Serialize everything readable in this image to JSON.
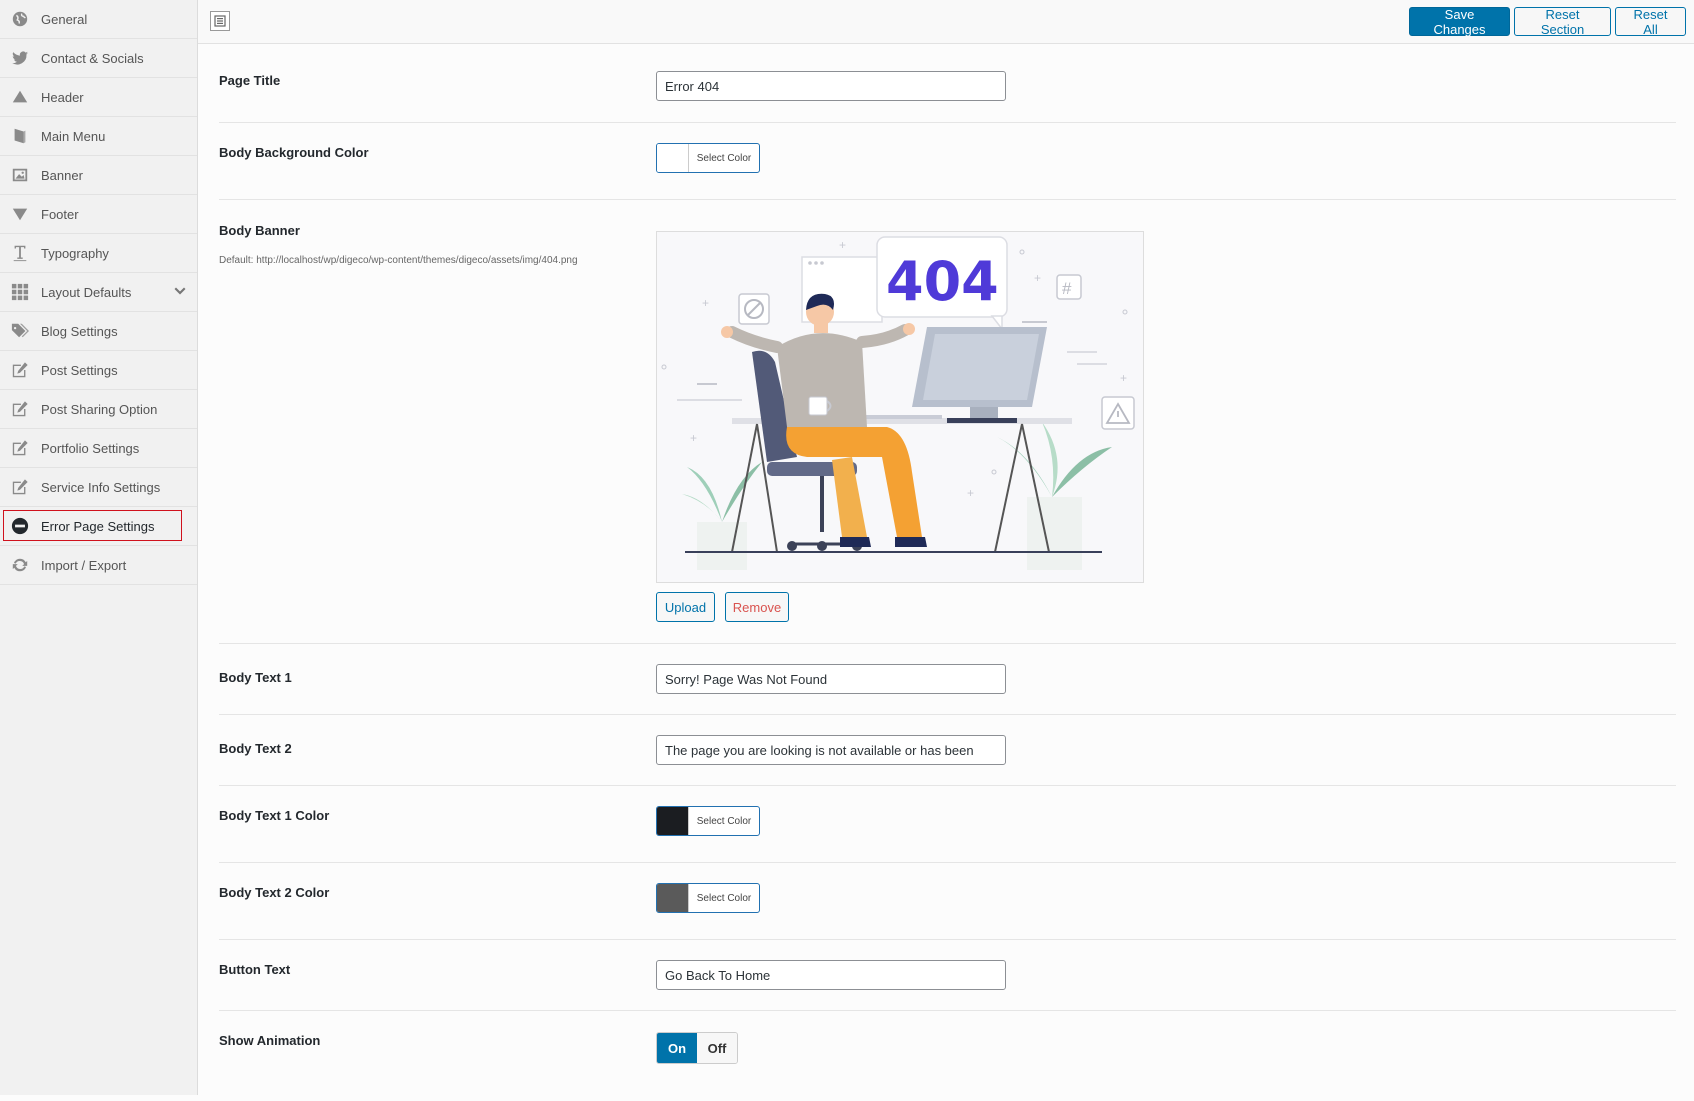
{
  "sidebar": {
    "items": [
      {
        "label": "General",
        "icon": "globe-icon"
      },
      {
        "label": "Contact & Socials",
        "icon": "twitter-icon"
      },
      {
        "label": "Header",
        "icon": "triangle-up-icon"
      },
      {
        "label": "Main Menu",
        "icon": "book-icon"
      },
      {
        "label": "Banner",
        "icon": "image-icon"
      },
      {
        "label": "Footer",
        "icon": "triangle-down-icon"
      },
      {
        "label": "Typography",
        "icon": "text-icon"
      },
      {
        "label": "Layout Defaults",
        "icon": "grid-icon"
      },
      {
        "label": "Blog Settings",
        "icon": "tags-icon"
      },
      {
        "label": "Post Settings",
        "icon": "edit-icon"
      },
      {
        "label": "Post Sharing Option",
        "icon": "edit-icon"
      },
      {
        "label": "Portfolio Settings",
        "icon": "edit-icon"
      },
      {
        "label": "Service Info Settings",
        "icon": "edit-icon"
      },
      {
        "label": "Error Page Settings",
        "icon": "minus-circle-icon"
      },
      {
        "label": "Import / Export",
        "icon": "refresh-icon"
      }
    ]
  },
  "toolbar": {
    "save_label": "Save Changes",
    "reset_section_label": "Reset Section",
    "reset_all_label": "Reset All"
  },
  "fields": {
    "page_title": {
      "label": "Page Title",
      "value": "Error 404"
    },
    "body_bg_color": {
      "label": "Body Background Color",
      "button": "Select Color",
      "swatch": "#ffffff"
    },
    "body_banner": {
      "label": "Body Banner",
      "desc": "Default: http://localhost/wp/digeco/wp-content/themes/digeco/assets/img/404.png",
      "banner_text": "404",
      "upload": "Upload",
      "remove": "Remove"
    },
    "body_text_1": {
      "label": "Body Text 1",
      "value": "Sorry! Page Was Not Found"
    },
    "body_text_2": {
      "label": "Body Text 2",
      "value": "The page you are looking is not available or has been"
    },
    "body_text_1_color": {
      "label": "Body Text 1 Color",
      "button": "Select Color",
      "swatch": "#1b1d21"
    },
    "body_text_2_color": {
      "label": "Body Text 2 Color",
      "button": "Select Color",
      "swatch": "#5a5a5a"
    },
    "button_text": {
      "label": "Button Text",
      "value": "Go Back To Home"
    },
    "show_animation": {
      "label": "Show Animation",
      "on": "On",
      "off": "Off"
    }
  }
}
